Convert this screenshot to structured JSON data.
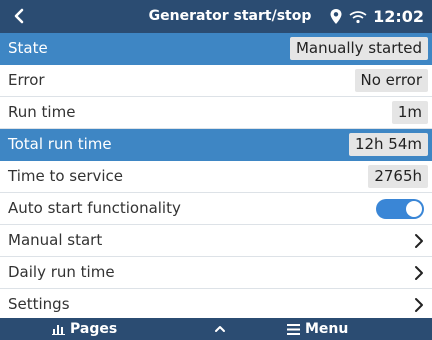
{
  "header": {
    "title": "Generator start/stop",
    "clock": "12:02",
    "back_icon": "chevron-left-icon",
    "location_icon": "location-pin-icon",
    "wifi_icon": "wifi-icon"
  },
  "rows": [
    {
      "label": "State",
      "value": "Manually started",
      "selected": true
    },
    {
      "label": "Error",
      "value": "No error"
    },
    {
      "label": "Run time",
      "value": "1m"
    },
    {
      "label": "Total run time",
      "value": "12h 54m",
      "selected": true
    },
    {
      "label": "Time to service",
      "value": "2765h"
    },
    {
      "label": "Auto start functionality",
      "toggle_on": true
    },
    {
      "label": "Manual start",
      "icon": "chevron-right-icon"
    },
    {
      "label": "Daily run time",
      "icon": "chevron-right-icon"
    },
    {
      "label": "Settings",
      "icon": "chevron-right-icon"
    }
  ],
  "footer": {
    "pages_label": "Pages",
    "menu_label": "Menu",
    "pages_icon": "bar-chart-icon",
    "up_icon": "chevron-up-icon",
    "menu_icon": "hamburger-menu-icon"
  },
  "colors": {
    "header_bg": "#2b4c72",
    "selected_row": "#3e86c4",
    "toggle_on": "#3a86d6"
  }
}
